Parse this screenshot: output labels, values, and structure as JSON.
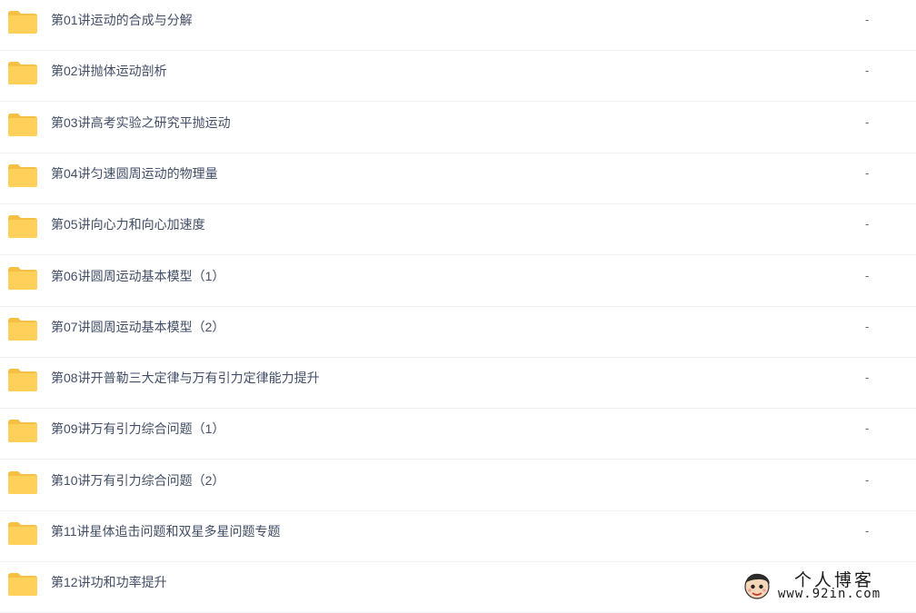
{
  "files": [
    {
      "name": "第01讲运动的合成与分解",
      "size": "-"
    },
    {
      "name": "第02讲抛体运动剖析",
      "size": "-"
    },
    {
      "name": "第03讲高考实验之研究平抛运动",
      "size": "-"
    },
    {
      "name": "第04讲匀速圆周运动的物理量",
      "size": "-"
    },
    {
      "name": "第05讲向心力和向心加速度",
      "size": "-"
    },
    {
      "name": "第06讲圆周运动基本模型（1）",
      "size": "-"
    },
    {
      "name": "第07讲圆周运动基本模型（2）",
      "size": "-"
    },
    {
      "name": "第08讲开普勒三大定律与万有引力定律能力提升",
      "size": "-"
    },
    {
      "name": "第09讲万有引力综合问题（1）",
      "size": "-"
    },
    {
      "name": "第10讲万有引力综合问题（2）",
      "size": "-"
    },
    {
      "name": "第11讲星体追击问题和双星多星问题专题",
      "size": "-"
    },
    {
      "name": "第12讲功和功率提升",
      "size": ""
    }
  ],
  "watermark": {
    "title": "个人博客",
    "url": "www.92in.com"
  },
  "colors": {
    "folder": "#ffd15a",
    "folder_tab": "#f5c043",
    "text": "#424e67",
    "divider": "#f1f2f4"
  }
}
